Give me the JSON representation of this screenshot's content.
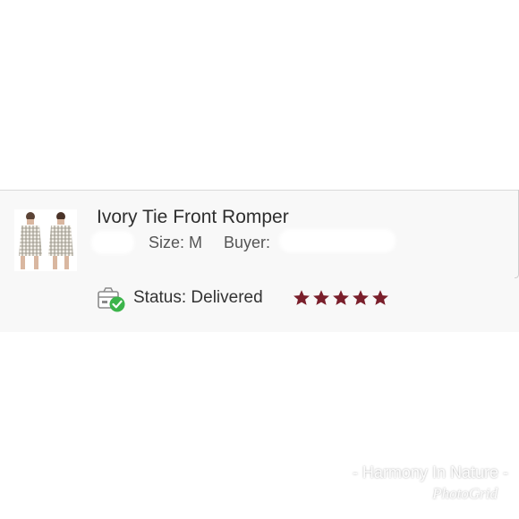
{
  "product": {
    "title": "Ivory Tie Front Romper",
    "size_label": "Size: M",
    "buyer_label": "Buyer:"
  },
  "status": {
    "text": "Status: Delivered",
    "icon": "package-delivered-icon"
  },
  "rating": {
    "stars": 5,
    "max": 5,
    "color": "#7a1f2b"
  },
  "watermark": {
    "line1": "- Harmony In Nature -",
    "line2": "PhotoGrid"
  },
  "colors": {
    "card_background": "#f8f8f8",
    "star": "#7a1f2b",
    "check": "#3cb44b"
  }
}
